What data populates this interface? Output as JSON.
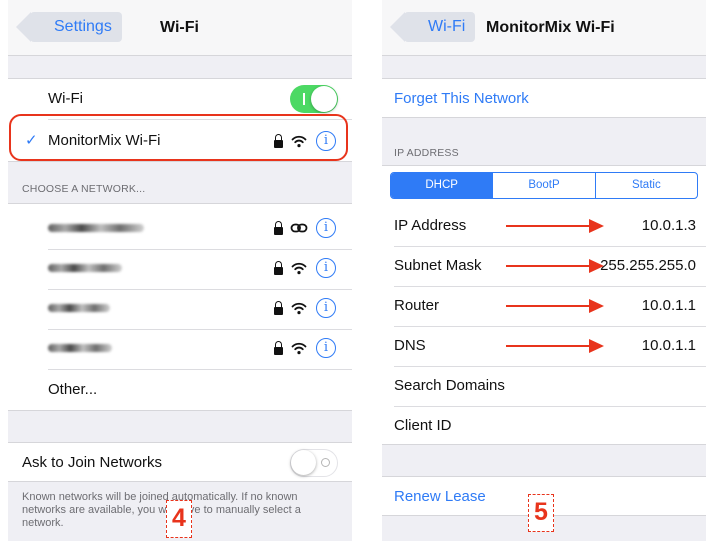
{
  "left": {
    "nav": {
      "back_label": "Settings",
      "title": "Wi-Fi"
    },
    "wifi_row": {
      "label": "Wi-Fi",
      "toggle": "on"
    },
    "connected_network": {
      "check": "✓",
      "name": "MonitorMix Wi-Fi",
      "icons": [
        "lock-icon",
        "wifi-icon",
        "info-icon"
      ]
    },
    "choose_header": "CHOOSE A NETWORK...",
    "networks": [
      {
        "name_obscured": true,
        "icons": [
          "lock-icon",
          "link-icon",
          "info-icon"
        ]
      },
      {
        "name_obscured": true,
        "icons": [
          "lock-icon",
          "wifi-icon",
          "info-icon"
        ]
      },
      {
        "name_obscured": true,
        "icons": [
          "lock-icon",
          "wifi-icon",
          "info-icon"
        ]
      },
      {
        "name_obscured": true,
        "icons": [
          "lock-icon",
          "wifi-icon",
          "info-icon"
        ]
      }
    ],
    "other_label": "Other...",
    "ask_to_join": {
      "label": "Ask to Join Networks",
      "toggle": "off"
    },
    "footer_note": "Known networks will be joined automatically. If no known networks are available, you will have to manually select a network.",
    "step_badge": "4"
  },
  "right": {
    "nav": {
      "back_label": "Wi-Fi",
      "title": "MonitorMix Wi-Fi"
    },
    "forget_label": "Forget This Network",
    "ip_header": "IP ADDRESS",
    "segments": [
      "DHCP",
      "BootP",
      "Static"
    ],
    "selected_segment": "DHCP",
    "rows": [
      {
        "label": "IP Address",
        "value": "10.0.1.3"
      },
      {
        "label": "Subnet Mask",
        "value": "255.255.255.0"
      },
      {
        "label": "Router",
        "value": "10.0.1.1"
      },
      {
        "label": "DNS",
        "value": "10.0.1.1"
      },
      {
        "label": "Search Domains",
        "value": ""
      },
      {
        "label": "Client ID",
        "value": ""
      }
    ],
    "renew_label": "Renew Lease",
    "step_badge": "5"
  },
  "colors": {
    "accent": "#2f7bf6",
    "annotation": "#e8341c",
    "toggle_on": "#4cd964",
    "grouped_background": "#efeff4"
  }
}
